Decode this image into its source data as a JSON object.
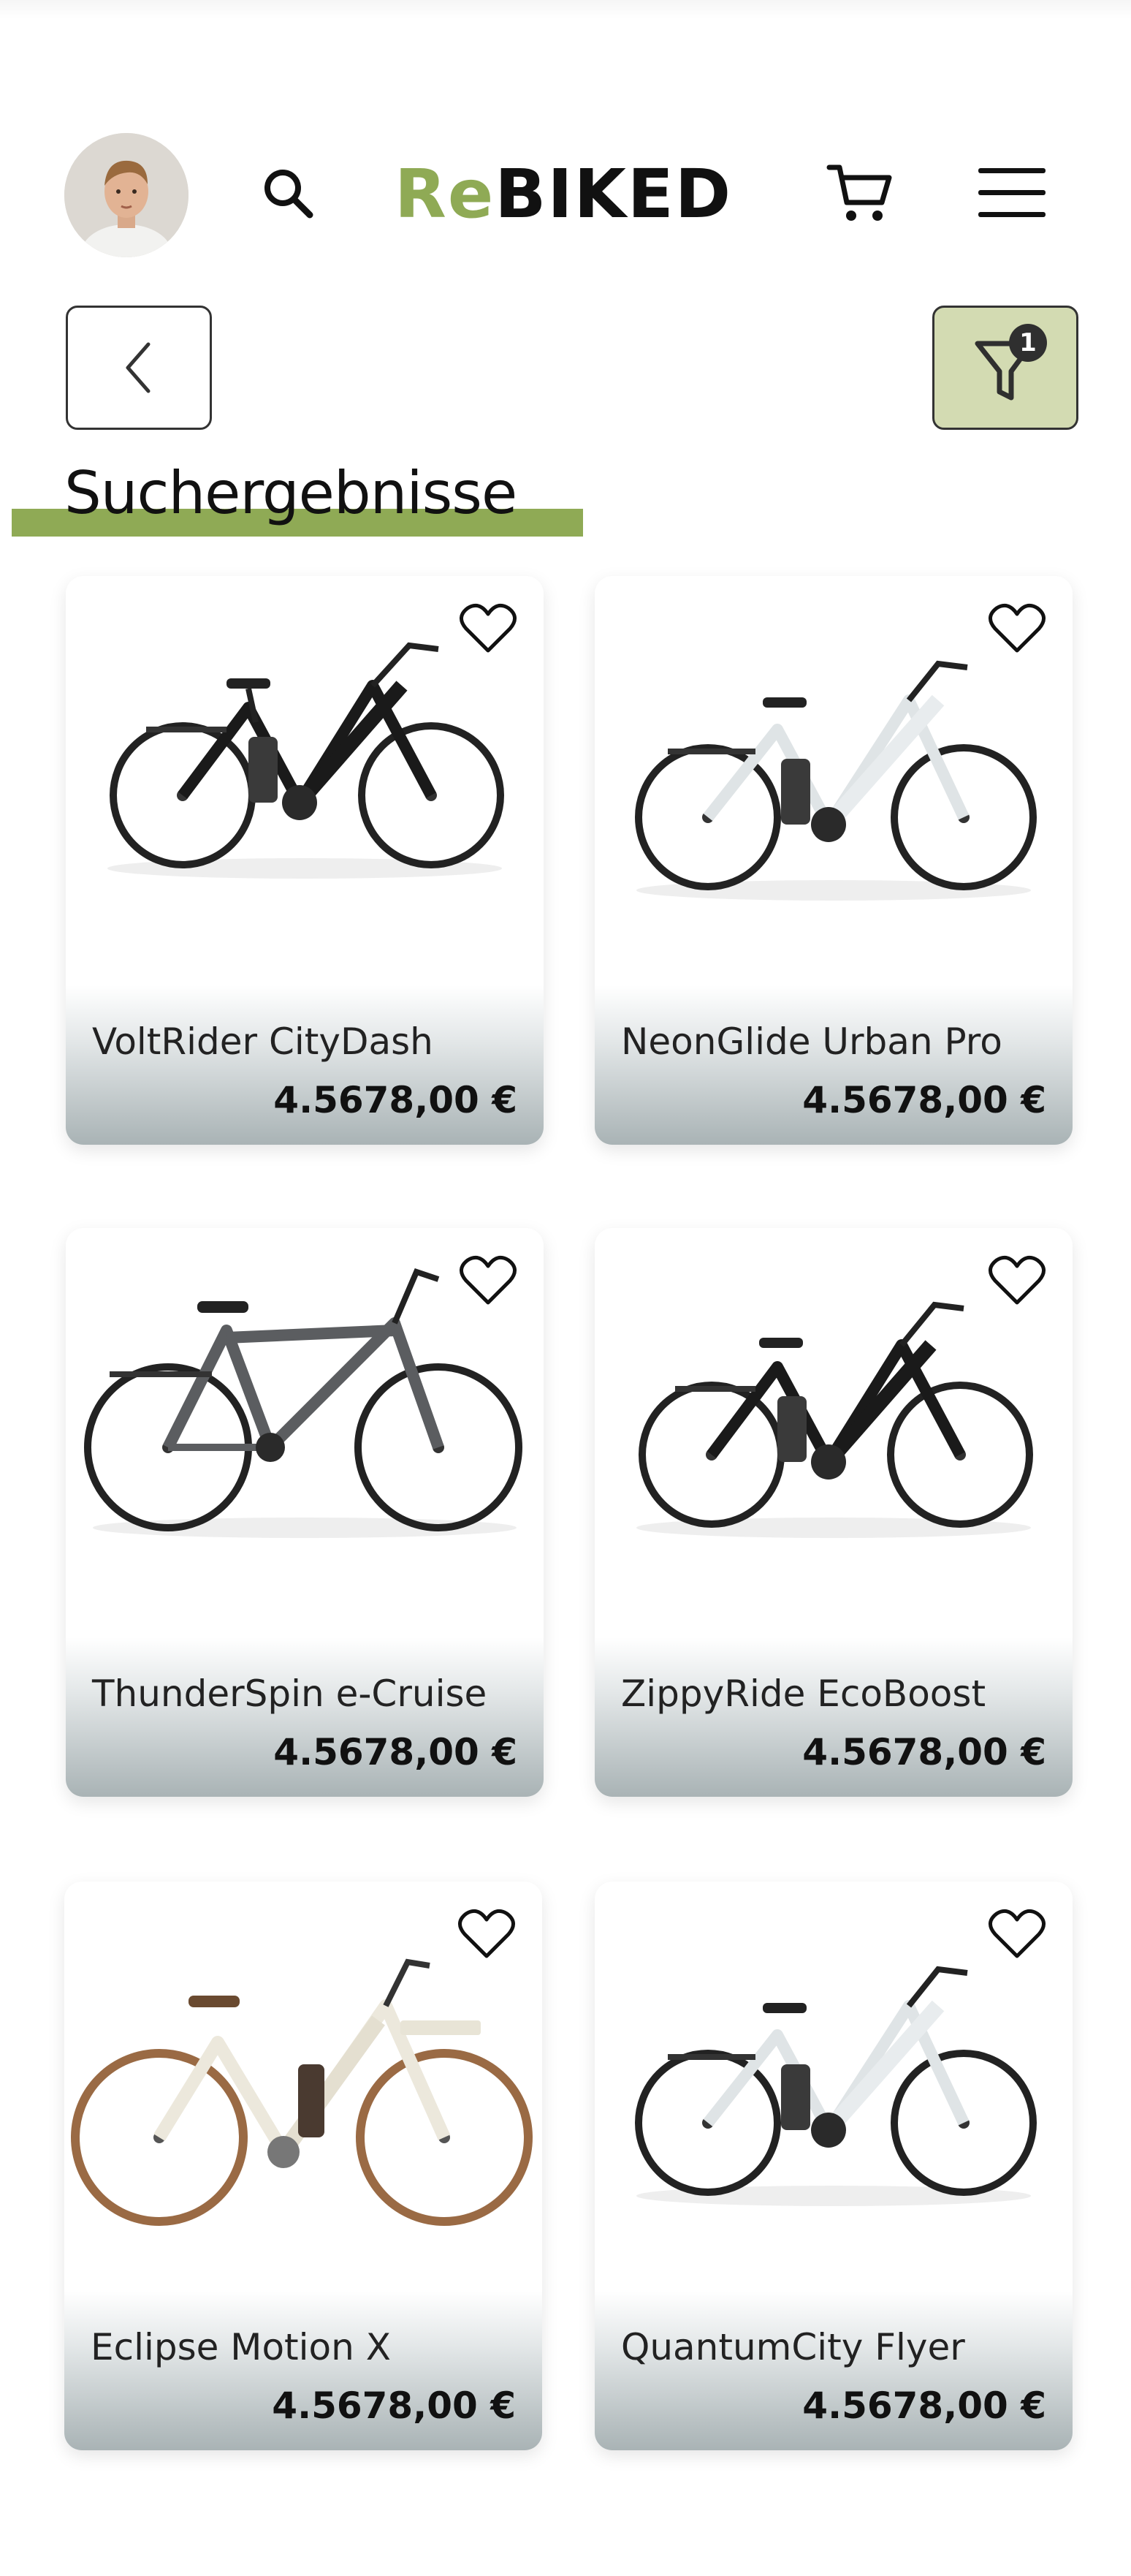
{
  "header": {
    "logo_re": "Re",
    "logo_biked": "BIKED",
    "icons": [
      "avatar",
      "search-icon",
      "cart-icon",
      "menu-icon"
    ]
  },
  "toolbar": {
    "back_icon": "chevron-left-icon",
    "filter_icon": "filter-icon",
    "filter_count": "1"
  },
  "page": {
    "title": "Suchergebnisse",
    "accent_color": "#8faa55",
    "filter_bg": "#d3dbb2"
  },
  "products": [
    {
      "name": "VoltRider CityDash",
      "price": "4.5678,00 €",
      "frame_color": "#1a1a1a",
      "style": "step-through"
    },
    {
      "name": "NeonGlide Urban Pro",
      "price": "4.5678,00 €",
      "frame_color": "#e8ecee",
      "style": "step-through"
    },
    {
      "name": "ThunderSpin e-Cruise",
      "price": "4.5678,00 €",
      "frame_color": "#5b5d60",
      "style": "diamond"
    },
    {
      "name": "ZippyRide EcoBoost",
      "price": "4.5678,00 €",
      "frame_color": "#1a1a1a",
      "style": "step-through"
    },
    {
      "name": "Eclipse Motion X",
      "price": "4.5678,00 €",
      "frame_color": "#ece8dc",
      "style": "retro"
    },
    {
      "name": "QuantumCity Flyer",
      "price": "4.5678,00 €",
      "frame_color": "#e8ecee",
      "style": "step-through"
    }
  ]
}
